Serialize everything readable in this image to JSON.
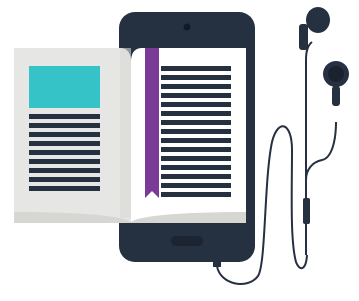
{
  "scene": {
    "icons": [
      "smartphone-icon",
      "open-book-icon",
      "bookmark-ribbon-icon",
      "earphones-icon"
    ]
  },
  "colors": {
    "phone_body": "#253040",
    "book_page": "#ffffff",
    "book_page_shadow": "#e2e2e0",
    "book_edge": "#d3d3d1",
    "text_lines": "#253040",
    "image_block": "#35c3c7",
    "bookmark": "#7a3b96",
    "cable": "#253040"
  }
}
